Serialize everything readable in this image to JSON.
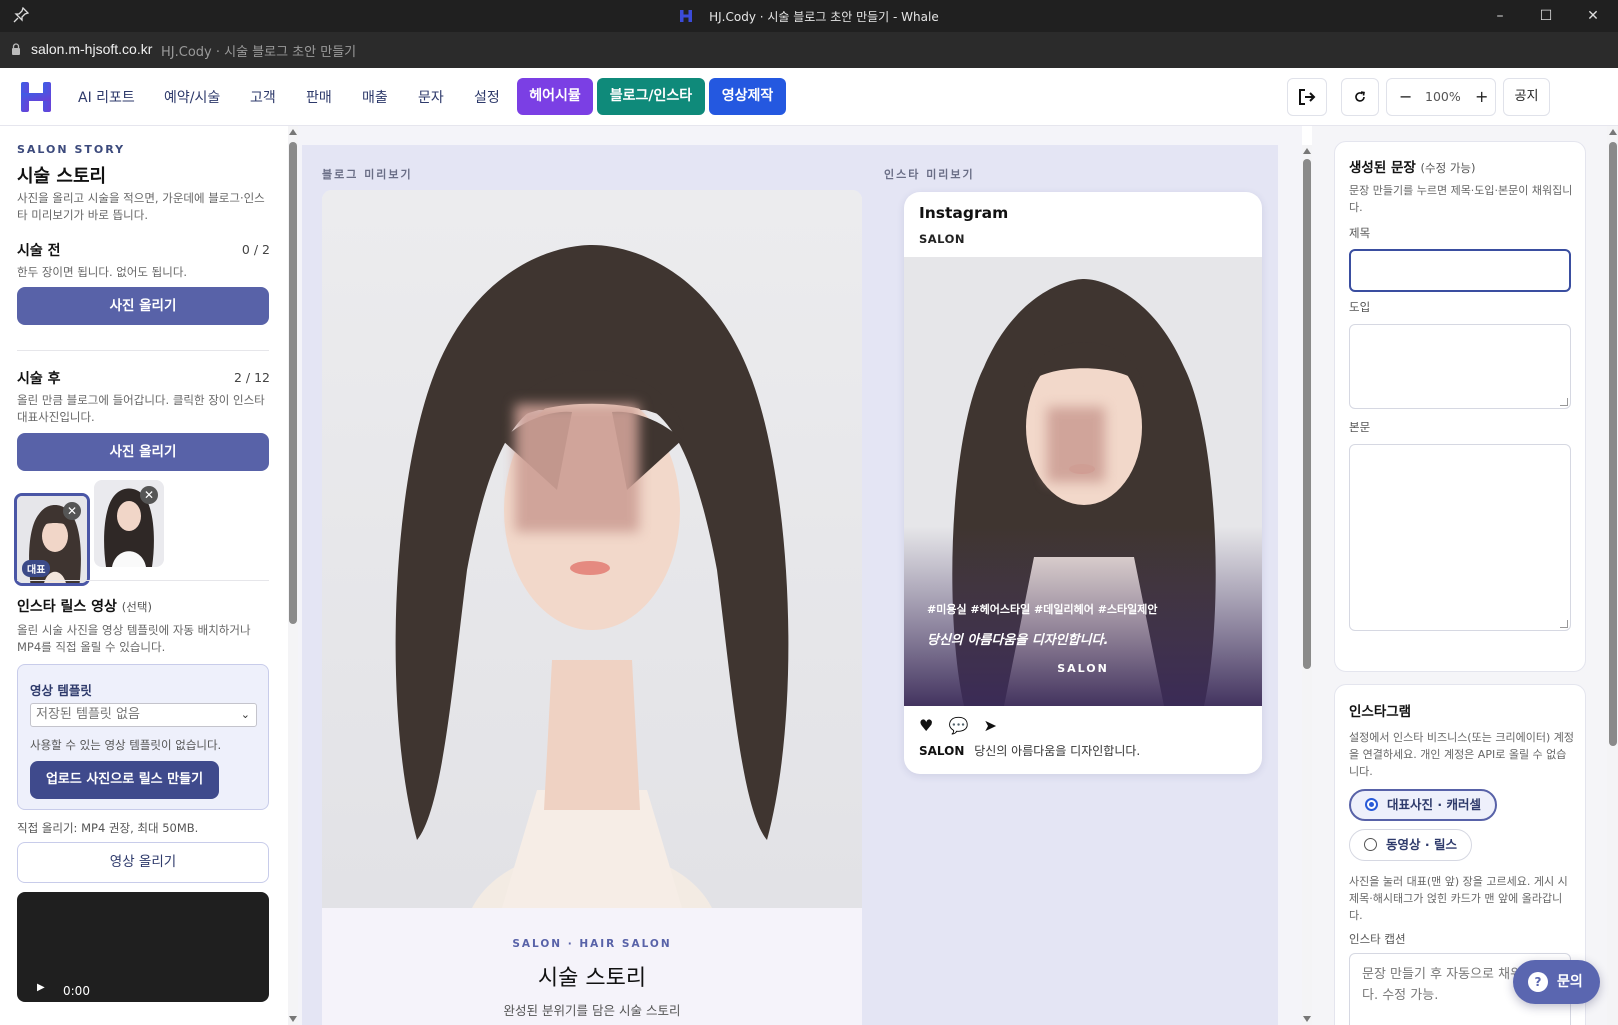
{
  "window": {
    "title": "HJ.Cody · 시술 블로그 초안 만들기 - Whale",
    "minimize": "–",
    "maximize": "☐",
    "close": "✕"
  },
  "address": {
    "url": "salon.m-hjsoft.co.kr",
    "page_title": "HJ.Cody · 시술 블로그 초안 만들기"
  },
  "nav": {
    "items": [
      "AI 리포트",
      "예약/시술",
      "고객",
      "판매",
      "매출",
      "문자",
      "설정"
    ],
    "buttons": [
      {
        "label": "헤어시뮬",
        "color": "#7b3fe4"
      },
      {
        "label": "블로그/인스타",
        "color": "#0f8a7a"
      },
      {
        "label": "영상제작",
        "color": "#2458e0"
      }
    ],
    "zoom": "100%",
    "zoom_minus": "−",
    "zoom_plus": "+",
    "notice": "공지"
  },
  "left": {
    "eyebrow": "SALON STORY",
    "title": "시술 스토리",
    "desc": "사진을 올리고 시술을 적으면, 가운데에 블로그·인스타 미리보기가 바로 뜹니다.",
    "before": {
      "title": "시술 전",
      "count": "0 / 2",
      "desc": "한두 장이면 됩니다. 없어도 됩니다.",
      "upload": "사진 올리기"
    },
    "after": {
      "title": "시술 후",
      "count": "2 / 12",
      "desc": "올린 만큼 블로그에 들어갑니다. 클릭한 장이 인스타 대표사진입니다.",
      "upload": "사진 올리기",
      "rep_badge": "대표"
    },
    "reels": {
      "title": "인스타 릴스 영상",
      "title_suffix": "(선택)",
      "desc": "올린 시술 사진을 영상 템플릿에 자동 배치하거나 MP4를 직접 올릴 수 있습니다.",
      "template_label": "영상 템플릿",
      "template_select": "저장된 템플릿 없음",
      "template_help": "사용할 수 있는 영상 템플릿이 없습니다.",
      "template_button": "업로드 사진으로 릴스 만들기",
      "direct_help": "직접 올리기: MP4 권장, 최대 50MB.",
      "video_upload": "영상 올리기",
      "video_time": "0:00"
    }
  },
  "center": {
    "blog_label": "블로그 미리보기",
    "insta_label": "인스타 미리보기",
    "blog": {
      "eyebrow": "SALON · HAIR SALON",
      "title": "시술 스토리",
      "subtitle": "완성된 분위기를 담은 시술 스토리"
    },
    "insta": {
      "brand": "Instagram",
      "user": "SALON",
      "tags": "#미용실 #헤어스타일 #데일리헤어 #스타일제안",
      "quote": "당신의 아름다움을 디자인합니다.",
      "overlay_salon": "SALON",
      "caption_user": "SALON",
      "caption_text": "당신의 아름다움을 디자인합니다."
    }
  },
  "right": {
    "generated": {
      "title": "생성된 문장",
      "title_suffix": "(수정 가능)",
      "desc": "문장 만들기를 누르면 제목·도입·본문이 채워집니다.",
      "label_title": "제목",
      "label_intro": "도입",
      "label_body": "본문"
    },
    "instagram": {
      "title": "인스타그램",
      "desc": "설정에서 인스타 비즈니스(또는 크리에이터) 계정을 연결하세요. 개인 계정은 API로 올릴 수 없습니다.",
      "option_photo": "대표사진 · 캐러셀",
      "option_video": "동영상 · 릴스",
      "help": "사진을 눌러 대표(맨 앞) 장을 고르세요. 게시 시 제목·해시태그가 얹힌 카드가 맨 앞에 올라갑니다.",
      "caption_label": "인스타 캡션",
      "caption_placeholder": "문장 만들기 후 자동으로 채워집니다. 수정 가능."
    }
  },
  "help_button": "문의"
}
